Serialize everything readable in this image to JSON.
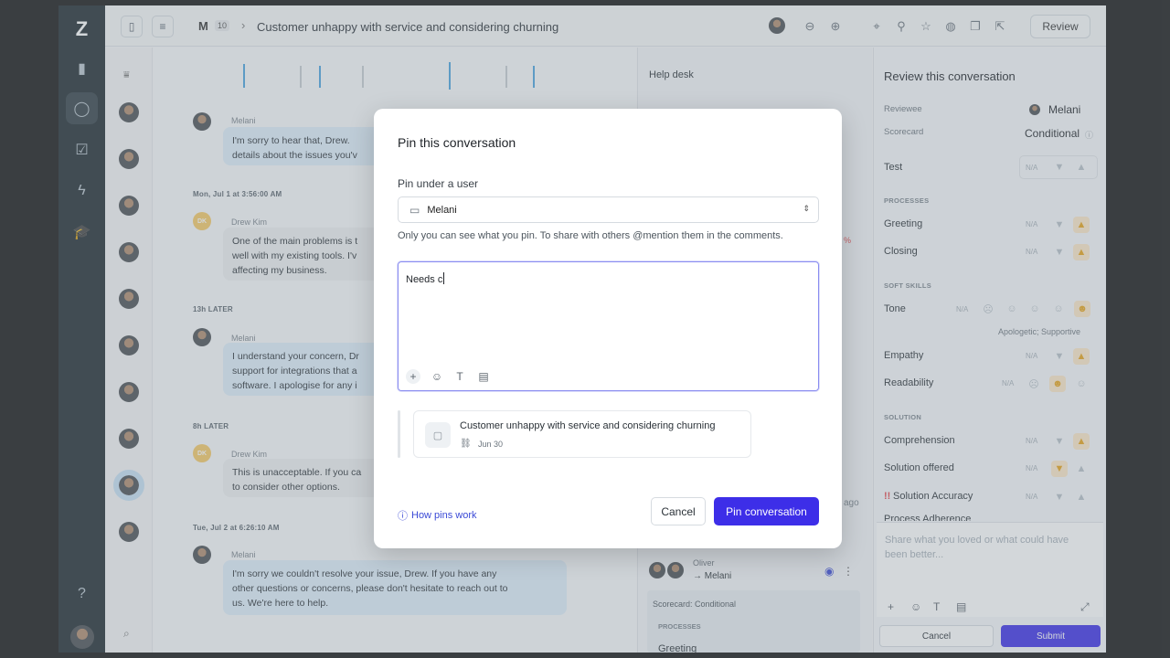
{
  "app": {
    "logo": "Z"
  },
  "topbar": {
    "badge_letter": "M",
    "badge_count": "10",
    "breadcrumb_sep": "›",
    "title": "Customer unhappy with service and considering churning",
    "review_label": "Review"
  },
  "conversation": {
    "messages": [
      {
        "author": "Melani",
        "text_l1": "I'm sorry to hear that, Drew.",
        "text_l2": "details about the issues you'v"
      },
      {
        "timestamp": "Mon, Jul 1 at 3:56:00 AM"
      },
      {
        "initials": "DK",
        "author": "Drew Kim",
        "text_l1": "One of the main problems is t",
        "text_l2": "well with my existing tools. I'v",
        "text_l3": "affecting my business."
      },
      {
        "timestamp": "13h LATER"
      },
      {
        "author": "Melani",
        "text_l1": "I understand your concern, Dr",
        "text_l2": "support for integrations that a",
        "text_l3": "software. I apologise for any i"
      },
      {
        "timestamp": "8h LATER"
      },
      {
        "initials": "DK",
        "author": "Drew Kim",
        "text_l1": "This is unacceptable. If you ca",
        "text_l2": "to consider other options."
      },
      {
        "timestamp": "Tue, Jul 2 at 6:26:10 AM"
      },
      {
        "author": "Melani",
        "text_l1": "I'm sorry we couldn't resolve your issue, Drew. If you have any",
        "text_l2": "other questions or concerns, please don't hesitate to reach out to",
        "text_l3": "us. We're here to help."
      }
    ]
  },
  "middle": {
    "help_desk": "Help desk",
    "pct": "%",
    "ago": "ago",
    "reviewer_from": "Oliver",
    "reviewer_to": "→ Melani",
    "scorecard": "Scorecard: Conditional",
    "processes": "PROCESSES",
    "greeting": "Greeting"
  },
  "review": {
    "title": "Review this conversation",
    "reviewee_label": "Reviewee",
    "reviewee_value": "Melani",
    "scorecard_label": "Scorecard",
    "scorecard_value": "Conditional",
    "na": "N/A",
    "rows": {
      "test": "Test",
      "sec_processes": "PROCESSES",
      "greeting": "Greeting",
      "closing": "Closing",
      "sec_soft": "SOFT SKILLS",
      "tone": "Tone",
      "tone_sub": "Apologetic; Supportive",
      "empathy": "Empathy",
      "readability": "Readability",
      "sec_solution": "SOLUTION",
      "comprehension": "Comprehension",
      "solution_offered": "Solution offered",
      "solution_accuracy": "Solution Accuracy",
      "process_adherence": "Process Adherence"
    },
    "comment_placeholder_l1": "Share what you loved or what could have",
    "comment_placeholder_l2": "been better...",
    "cancel": "Cancel",
    "submit": "Submit"
  },
  "modal": {
    "title": "Pin this conversation",
    "pin_under_label": "Pin under a user",
    "user_value": "Melani",
    "hint": "Only you can see what you pin. To share with others @mention them in the comments.",
    "note_value": "Needs c",
    "card_title": "Customer unhappy with service and considering churning",
    "card_date": "Jun 30",
    "how_pins_work": "How pins work",
    "cancel": "Cancel",
    "pin": "Pin conversation"
  },
  "colors": {
    "primary": "#3d2ee8",
    "bubble": "#dfeefb",
    "sidebar": "#1f2a30"
  }
}
